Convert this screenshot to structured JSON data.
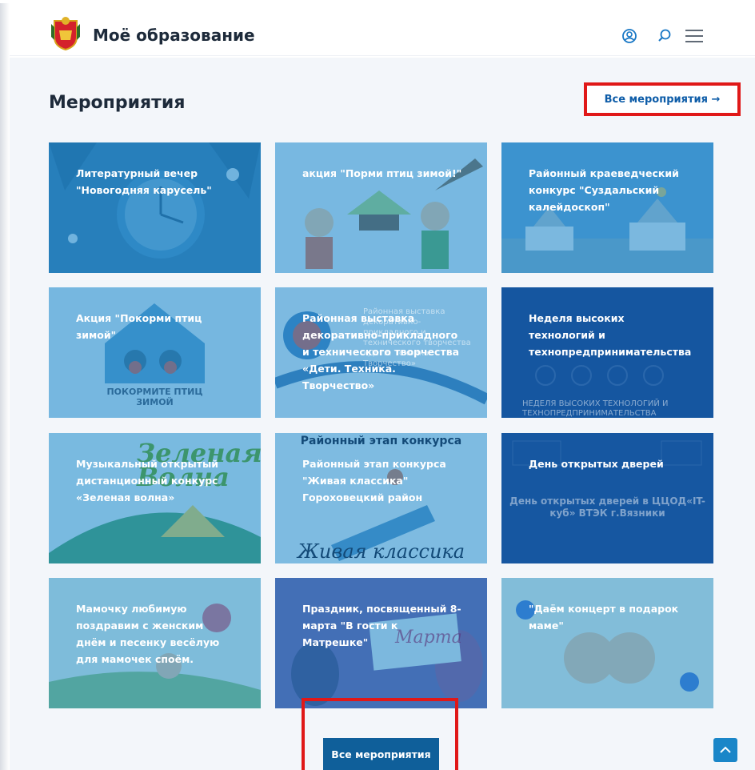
{
  "header": {
    "brand": "Моё образование",
    "icons": [
      "user-icon",
      "search-icon",
      "menu-icon"
    ]
  },
  "section": {
    "title": "Мероприятия",
    "all_link_label": "Все мероприятия →"
  },
  "events": [
    {
      "title": "Литературный вечер \"Новогодняя карусель\"",
      "theme": "clock-winter"
    },
    {
      "title": "акция \"Порми птиц зимой!\"",
      "theme": "kids-feeder"
    },
    {
      "title": "Районный краеведческий конкурс \"Суздальский калейдоскоп\"",
      "theme": "town"
    },
    {
      "title": "Акция \"Покорми птиц зимой\"",
      "theme": "birds",
      "image_text": "ПОКОРМИТЕ ПТИЦ ЗИМОЙ"
    },
    {
      "title": "Районная выставка декоративно-прикладного и технического творчества «Дети. Техника. Творчество»",
      "theme": "exhibition",
      "image_text": "Районная выставка декоративно-прикладного и технического творчества «Дети. Техника. Творчество»"
    },
    {
      "title": "Неделя высоких технологий и технопредпринимательства",
      "theme": "tech",
      "image_text": "НЕДЕЛЯ ВЫСОКИХ ТЕХНОЛОГИЙ И ТЕХНОПРЕДПРИНИМАТЕЛЬСТВА"
    },
    {
      "title": "Музыкальный открытый дистанционный конкурс «Зеленая волна»",
      "theme": "green-wave",
      "image_text": "Зеленая Волна"
    },
    {
      "title": "Районный этап конкурса \"Живая классика\" Гороховецкий район",
      "theme": "classic",
      "image_text_top": "Районный этап конкурса",
      "image_text_bottom": "Живая классика"
    },
    {
      "title": "День открытых дверей",
      "theme": "open-doors",
      "image_text": "День открытых дверей в ЦЦОД«IT-куб» ВТЭК г.Вязники"
    },
    {
      "title": "Мамочку любимую поздравим с женским днём и песенку весёлую для мамочек споём.",
      "theme": "mother-day"
    },
    {
      "title": "Праздник, посвященный 8-марта \"В гости к Матрешке\"",
      "theme": "tulips",
      "image_text": "Марта"
    },
    {
      "title": "\"Даём концерт в подарок маме\"",
      "theme": "children"
    }
  ],
  "bottom_button": {
    "label": "Все мероприятия"
  },
  "colors": {
    "accent": "#0f5f9a",
    "highlight": "#e01818",
    "card_overlay": "#228ccd"
  }
}
